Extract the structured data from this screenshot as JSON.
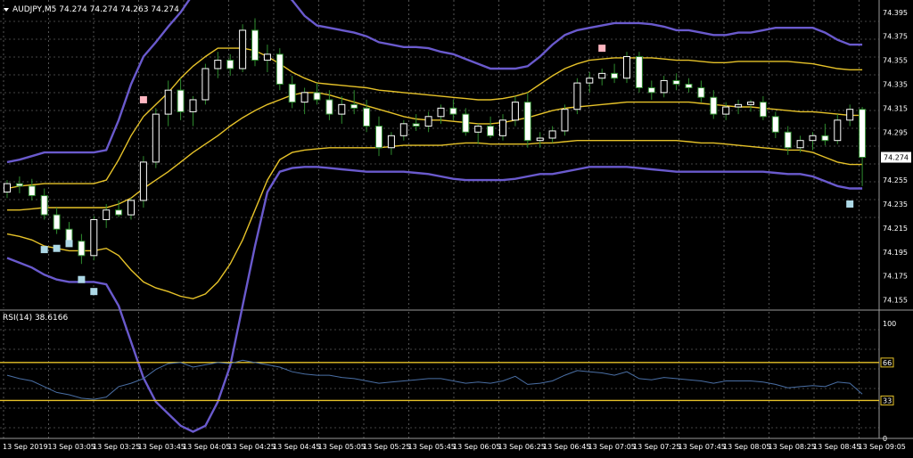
{
  "header": {
    "symbol_line": "AUDJPY,M5  74.274 74.274 74.263 74.274"
  },
  "rsi_header": "RSI(14) 38.6166",
  "colors": {
    "background": "#000000",
    "grid": "#8a8a8a",
    "bull": "#ffffff",
    "bear": "#ffffff",
    "wick": "#2e8b2e",
    "band_outer": "#6a5acd",
    "band_inner": "#e6c229",
    "rsi_line": "#4a6fa5",
    "rsi_level": "#e6c229",
    "price_tag_bg": "#ffffff",
    "marker_up": "#ffb6c1",
    "marker_down": "#add8e6"
  },
  "chart_data": [
    {
      "type": "candlestick",
      "title": "AUDJPY,M5",
      "ylim": [
        74.148,
        74.403
      ],
      "y_ticks": [
        "74.395",
        "74.375",
        "74.355",
        "74.335",
        "74.315",
        "74.295",
        "74.274",
        "74.255",
        "74.235",
        "74.215",
        "74.195",
        "74.175",
        "74.155"
      ],
      "current_price": "74.274",
      "x_ticks": [
        "13 Sep 2019",
        "13 Sep 03:05",
        "13 Sep 03:25",
        "13 Sep 03:45",
        "13 Sep 04:05",
        "13 Sep 04:25",
        "13 Sep 04:45",
        "13 Sep 05:05",
        "13 Sep 05:25",
        "13 Sep 05:45",
        "13 Sep 06:05",
        "13 Sep 06:25",
        "13 Sep 06:45",
        "13 Sep 07:05",
        "13 Sep 07:25",
        "13 Sep 07:45",
        "13 Sep 08:05",
        "13 Sep 08:25",
        "13 Sep 08:45",
        "13 Sep 09:05"
      ],
      "candles": [
        [
          74.245,
          74.255,
          74.24,
          74.252
        ],
        [
          74.252,
          74.258,
          74.244,
          74.25
        ],
        [
          74.25,
          74.256,
          74.238,
          74.242
        ],
        [
          74.242,
          74.248,
          74.222,
          74.226
        ],
        [
          74.226,
          74.232,
          74.21,
          74.214
        ],
        [
          74.214,
          74.22,
          74.2,
          74.204
        ],
        [
          74.204,
          74.21,
          74.185,
          74.192
        ],
        [
          74.192,
          74.225,
          74.188,
          74.222
        ],
        [
          74.222,
          74.235,
          74.215,
          74.23
        ],
        [
          74.23,
          74.238,
          74.224,
          74.226
        ],
        [
          74.226,
          74.24,
          74.222,
          74.238
        ],
        [
          74.238,
          74.275,
          74.232,
          74.27
        ],
        [
          74.27,
          74.315,
          74.265,
          74.31
        ],
        [
          74.31,
          74.338,
          74.3,
          74.33
        ],
        [
          74.33,
          74.34,
          74.305,
          74.312
        ],
        [
          74.312,
          74.325,
          74.3,
          74.322
        ],
        [
          74.322,
          74.352,
          74.318,
          74.348
        ],
        [
          74.348,
          74.362,
          74.34,
          74.355
        ],
        [
          74.355,
          74.36,
          74.342,
          74.348
        ],
        [
          74.348,
          74.385,
          74.345,
          74.38
        ],
        [
          74.38,
          74.39,
          74.35,
          74.355
        ],
        [
          74.355,
          74.368,
          74.345,
          74.36
        ],
        [
          74.36,
          74.365,
          74.33,
          74.335
        ],
        [
          74.335,
          74.342,
          74.315,
          74.32
        ],
        [
          74.32,
          74.332,
          74.31,
          74.328
        ],
        [
          74.328,
          74.336,
          74.318,
          74.322
        ],
        [
          74.322,
          74.33,
          74.305,
          74.31
        ],
        [
          74.31,
          74.325,
          74.302,
          74.318
        ],
        [
          74.318,
          74.33,
          74.31,
          74.315
        ],
        [
          74.315,
          74.322,
          74.295,
          74.3
        ],
        [
          74.3,
          74.308,
          74.275,
          74.282
        ],
        [
          74.282,
          74.295,
          74.276,
          74.292
        ],
        [
          74.292,
          74.305,
          74.288,
          74.302
        ],
        [
          74.302,
          74.31,
          74.296,
          74.3
        ],
        [
          74.3,
          74.312,
          74.295,
          74.308
        ],
        [
          74.308,
          74.318,
          74.302,
          74.315
        ],
        [
          74.315,
          74.322,
          74.305,
          74.31
        ],
        [
          74.31,
          74.315,
          74.292,
          74.295
        ],
        [
          74.295,
          74.302,
          74.285,
          74.3
        ],
        [
          74.3,
          74.308,
          74.29,
          74.292
        ],
        [
          74.292,
          74.31,
          74.288,
          74.305
        ],
        [
          74.305,
          74.325,
          74.3,
          74.32
        ],
        [
          74.32,
          74.328,
          74.282,
          74.288
        ],
        [
          74.288,
          74.295,
          74.282,
          74.29
        ],
        [
          74.29,
          74.3,
          74.286,
          74.296
        ],
        [
          74.296,
          74.318,
          74.292,
          74.314
        ],
        [
          74.314,
          74.34,
          74.31,
          74.336
        ],
        [
          74.336,
          74.345,
          74.328,
          74.34
        ],
        [
          74.34,
          74.348,
          74.334,
          74.344
        ],
        [
          74.344,
          74.352,
          74.336,
          74.34
        ],
        [
          74.34,
          74.362,
          74.336,
          74.358
        ],
        [
          74.358,
          74.362,
          74.328,
          74.332
        ],
        [
          74.332,
          74.338,
          74.322,
          74.328
        ],
        [
          74.328,
          74.342,
          74.324,
          74.338
        ],
        [
          74.338,
          74.344,
          74.33,
          74.335
        ],
        [
          74.335,
          74.34,
          74.328,
          74.332
        ],
        [
          74.332,
          74.338,
          74.32,
          74.324
        ],
        [
          74.324,
          74.33,
          74.306,
          74.31
        ],
        [
          74.31,
          74.32,
          74.305,
          74.316
        ],
        [
          74.316,
          74.322,
          74.31,
          74.318
        ],
        [
          74.318,
          74.322,
          74.312,
          74.32
        ],
        [
          74.32,
          74.325,
          74.305,
          74.308
        ],
        [
          74.308,
          74.312,
          74.29,
          74.295
        ],
        [
          74.295,
          74.3,
          74.276,
          74.282
        ],
        [
          74.282,
          74.292,
          74.278,
          74.288
        ],
        [
          74.288,
          74.295,
          74.28,
          74.292
        ],
        [
          74.292,
          74.302,
          74.284,
          74.288
        ],
        [
          74.288,
          74.31,
          74.285,
          74.305
        ],
        [
          74.305,
          74.318,
          74.3,
          74.314
        ],
        [
          74.314,
          74.316,
          74.25,
          74.274
        ]
      ],
      "bands": {
        "upper_outer": [
          74.27,
          74.272,
          74.275,
          74.278,
          74.278,
          74.278,
          74.278,
          74.278,
          74.28,
          74.305,
          74.335,
          74.358,
          74.37,
          74.383,
          74.395,
          74.41,
          74.425,
          74.432,
          74.43,
          74.43,
          74.428,
          74.422,
          74.415,
          74.405,
          74.392,
          74.384,
          74.382,
          74.38,
          74.378,
          74.375,
          74.37,
          74.368,
          74.366,
          74.366,
          74.365,
          74.362,
          74.36,
          74.356,
          74.352,
          74.348,
          74.348,
          74.348,
          74.35,
          74.358,
          74.368,
          74.376,
          74.38,
          74.382,
          74.384,
          74.386,
          74.386,
          74.386,
          74.385,
          74.383,
          74.38,
          74.38,
          74.378,
          74.376,
          74.376,
          74.378,
          74.378,
          74.38,
          74.382,
          74.382,
          74.382,
          74.382,
          74.378,
          74.372,
          74.368,
          74.368
        ],
        "upper_inner": [
          74.248,
          74.25,
          74.251,
          74.252,
          74.252,
          74.252,
          74.252,
          74.252,
          74.255,
          74.272,
          74.292,
          74.308,
          74.318,
          74.328,
          74.34,
          74.35,
          74.358,
          74.365,
          74.365,
          74.365,
          74.363,
          74.358,
          74.352,
          74.345,
          74.34,
          74.336,
          74.335,
          74.334,
          74.333,
          74.332,
          74.33,
          74.329,
          74.328,
          74.327,
          74.326,
          74.325,
          74.324,
          74.323,
          74.322,
          74.322,
          74.323,
          74.325,
          74.328,
          74.335,
          74.342,
          74.348,
          74.352,
          74.355,
          74.356,
          74.357,
          74.357,
          74.357,
          74.357,
          74.356,
          74.355,
          74.355,
          74.354,
          74.353,
          74.353,
          74.354,
          74.354,
          74.354,
          74.354,
          74.354,
          74.353,
          74.352,
          74.35,
          74.348,
          74.347,
          74.347
        ],
        "middle": [
          74.23,
          74.23,
          74.231,
          74.232,
          74.232,
          74.232,
          74.232,
          74.232,
          74.232,
          74.235,
          74.24,
          74.248,
          74.255,
          74.262,
          74.27,
          74.278,
          74.285,
          74.292,
          74.3,
          74.307,
          74.313,
          74.318,
          74.322,
          74.326,
          74.328,
          74.328,
          74.326,
          74.323,
          74.32,
          74.317,
          74.314,
          74.311,
          74.308,
          74.306,
          74.305,
          74.305,
          74.304,
          74.303,
          74.302,
          74.302,
          74.303,
          74.305,
          74.307,
          74.31,
          74.313,
          74.315,
          74.316,
          74.317,
          74.318,
          74.319,
          74.32,
          74.32,
          74.32,
          74.32,
          74.32,
          74.32,
          74.319,
          74.318,
          74.317,
          74.316,
          74.316,
          74.315,
          74.314,
          74.313,
          74.312,
          74.312,
          74.311,
          74.31,
          74.309,
          74.309
        ],
        "lower_inner": [
          74.21,
          74.208,
          74.205,
          74.2,
          74.198,
          74.196,
          74.196,
          74.196,
          74.198,
          74.192,
          74.18,
          74.17,
          74.165,
          74.162,
          74.158,
          74.156,
          74.16,
          74.17,
          74.185,
          74.205,
          74.23,
          74.255,
          74.272,
          74.278,
          74.28,
          74.281,
          74.282,
          74.282,
          74.282,
          74.282,
          74.282,
          74.283,
          74.284,
          74.284,
          74.284,
          74.284,
          74.285,
          74.286,
          74.286,
          74.285,
          74.285,
          74.285,
          74.285,
          74.286,
          74.286,
          74.287,
          74.288,
          74.288,
          74.288,
          74.288,
          74.288,
          74.288,
          74.288,
          74.288,
          74.288,
          74.287,
          74.286,
          74.286,
          74.285,
          74.284,
          74.283,
          74.282,
          74.281,
          74.28,
          74.28,
          74.278,
          74.274,
          74.27,
          74.268,
          74.268
        ],
        "lower_outer": [
          74.19,
          74.186,
          74.182,
          74.176,
          74.172,
          74.17,
          74.17,
          74.17,
          74.168,
          74.15,
          74.12,
          74.09,
          74.07,
          74.06,
          74.05,
          74.045,
          74.05,
          74.07,
          74.1,
          74.15,
          74.2,
          74.245,
          74.262,
          74.265,
          74.266,
          74.266,
          74.265,
          74.264,
          74.263,
          74.262,
          74.262,
          74.262,
          74.262,
          74.261,
          74.26,
          74.258,
          74.256,
          74.255,
          74.255,
          74.255,
          74.255,
          74.256,
          74.258,
          74.26,
          74.26,
          74.262,
          74.264,
          74.266,
          74.266,
          74.266,
          74.266,
          74.265,
          74.264,
          74.263,
          74.262,
          74.262,
          74.262,
          74.262,
          74.262,
          74.262,
          74.262,
          74.262,
          74.261,
          74.26,
          74.26,
          74.258,
          74.254,
          74.25,
          74.248,
          74.248
        ]
      },
      "markers_up": [
        [
          11,
          74.322
        ],
        [
          48,
          74.365
        ]
      ],
      "markers_down": [
        [
          3,
          74.197
        ],
        [
          4,
          74.198
        ],
        [
          5,
          74.202
        ],
        [
          6,
          74.172
        ],
        [
          7,
          74.162
        ],
        [
          68,
          74.235
        ]
      ]
    },
    {
      "type": "line",
      "title": "RSI(14) 38.6166",
      "ylim": [
        0,
        100
      ],
      "y_ticks": [
        "100",
        "66",
        "33",
        "0"
      ],
      "levels": [
        66,
        33
      ],
      "values": [
        55,
        52,
        50,
        45,
        40,
        38,
        35,
        34,
        36,
        45,
        48,
        52,
        60,
        65,
        66,
        62,
        64,
        66,
        65,
        68,
        66,
        64,
        62,
        58,
        56,
        55,
        55,
        53,
        52,
        50,
        48,
        49,
        50,
        51,
        52,
        52,
        50,
        48,
        49,
        48,
        50,
        54,
        47,
        48,
        50,
        55,
        59,
        58,
        57,
        55,
        58,
        52,
        51,
        53,
        52,
        51,
        50,
        48,
        50,
        50,
        50,
        49,
        47,
        44,
        45,
        46,
        45,
        49,
        48,
        38.6
      ]
    }
  ]
}
